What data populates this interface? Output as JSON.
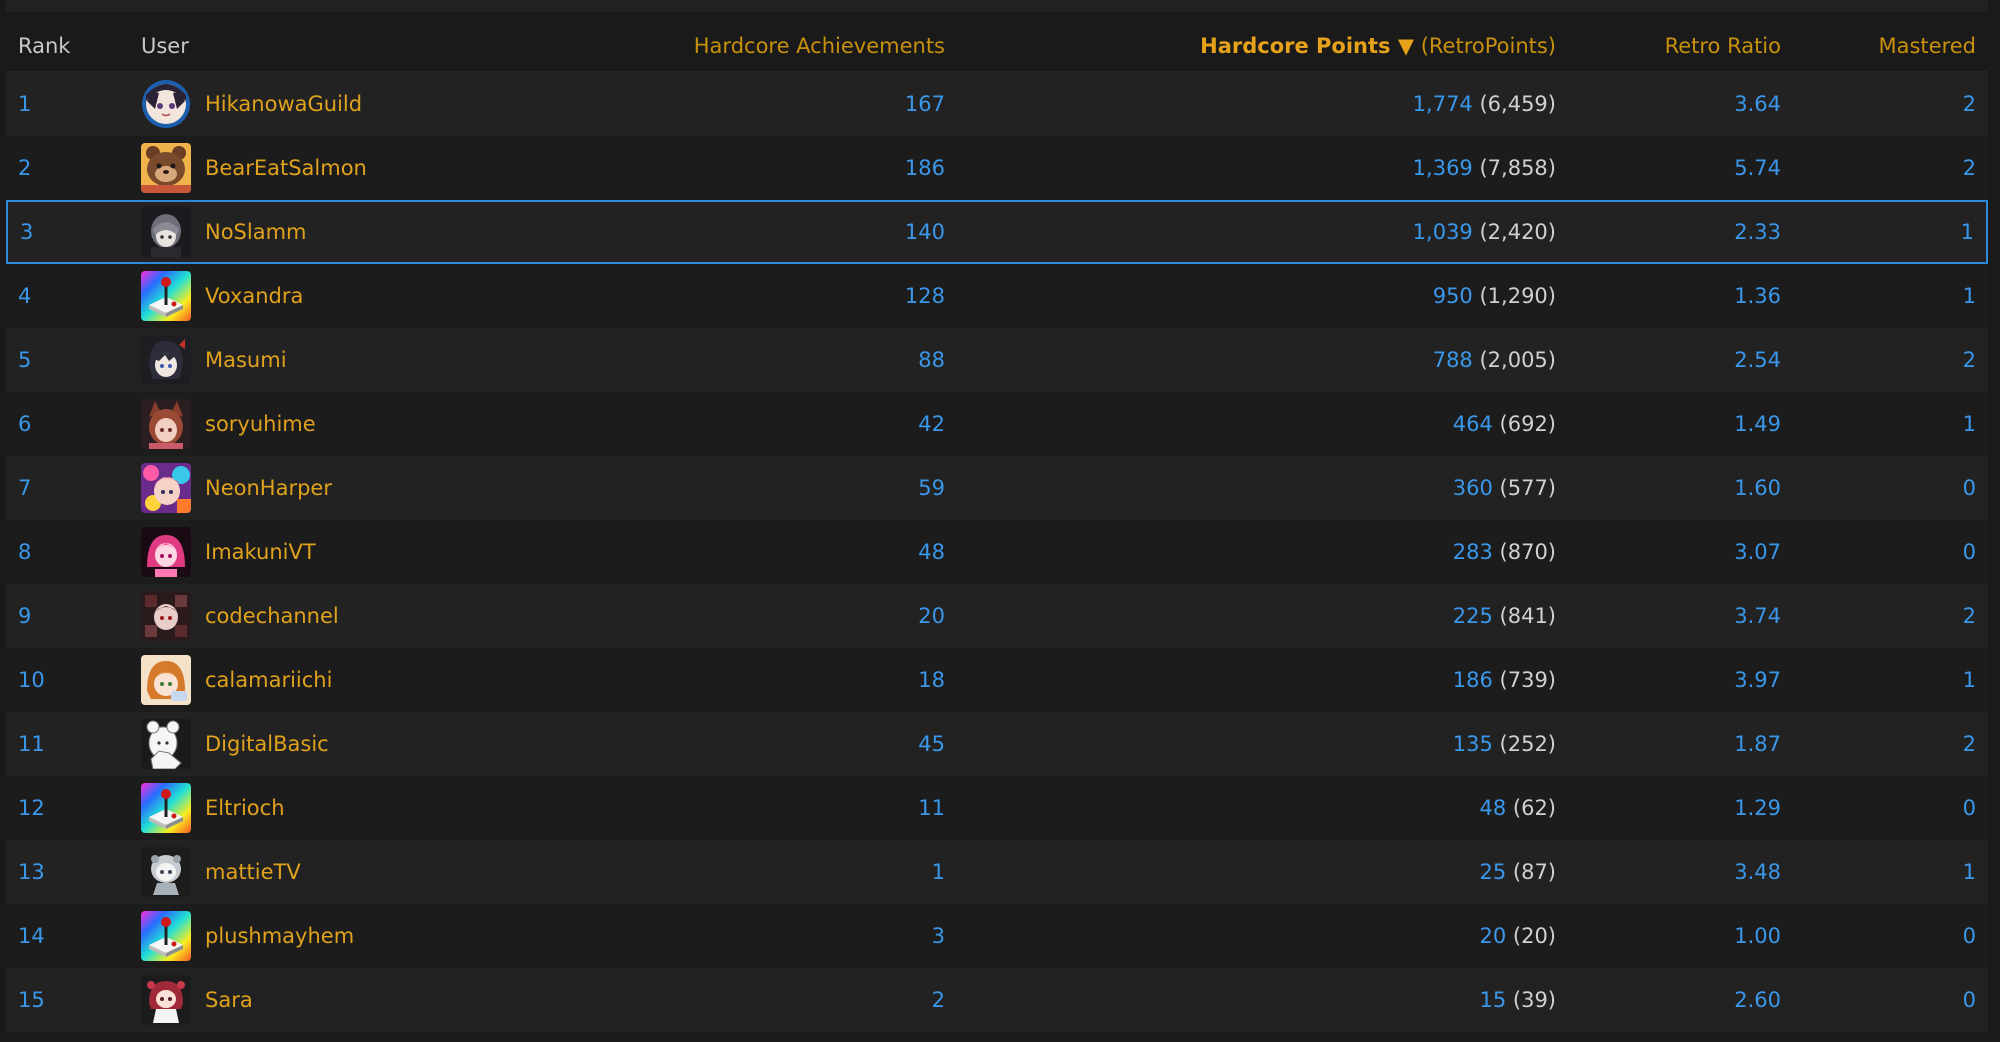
{
  "header": {
    "rank": "Rank",
    "user": "User",
    "hc_achievements": "Hardcore Achievements",
    "hc_points": "Hardcore Points ▼",
    "retropoints": "(RetroPoints)",
    "retro_ratio": "Retro Ratio",
    "mastered": "Mastered"
  },
  "rows": [
    {
      "rank": "1",
      "user": "HikanowaGuild",
      "achievements": "167",
      "points": "1,774",
      "retropoints": "(6,459)",
      "ratio": "3.64",
      "mastered": "2",
      "avatar_icon": "anime-avatar-blue-ring"
    },
    {
      "rank": "2",
      "user": "BearEatSalmon",
      "achievements": "186",
      "points": "1,369",
      "retropoints": "(7,858)",
      "ratio": "5.74",
      "mastered": "2",
      "avatar_icon": "bear-avatar"
    },
    {
      "rank": "3",
      "user": "NoSlamm",
      "achievements": "140",
      "points": "1,039",
      "retropoints": "(2,420)",
      "ratio": "2.33",
      "mastered": "1",
      "avatar_icon": "grey-hair-avatar"
    },
    {
      "rank": "4",
      "user": "Voxandra",
      "achievements": "128",
      "points": "950",
      "retropoints": "(1,290)",
      "ratio": "1.36",
      "mastered": "1",
      "avatar_icon": "rainbow-joystick-avatar"
    },
    {
      "rank": "5",
      "user": "Masumi",
      "achievements": "88",
      "points": "788",
      "retropoints": "(2,005)",
      "ratio": "2.54",
      "mastered": "2",
      "avatar_icon": "dark-hair-avatar"
    },
    {
      "rank": "6",
      "user": "soryuhime",
      "achievements": "42",
      "points": "464",
      "retropoints": "(692)",
      "ratio": "1.49",
      "mastered": "1",
      "avatar_icon": "cat-ears-avatar"
    },
    {
      "rank": "7",
      "user": "NeonHarper",
      "achievements": "59",
      "points": "360",
      "retropoints": "(577)",
      "ratio": "1.60",
      "mastered": "0",
      "avatar_icon": "colorful-avatar"
    },
    {
      "rank": "8",
      "user": "ImakuniVT",
      "achievements": "48",
      "points": "283",
      "retropoints": "(870)",
      "ratio": "3.07",
      "mastered": "0",
      "avatar_icon": "pink-avatar"
    },
    {
      "rank": "9",
      "user": "codechannel",
      "achievements": "20",
      "points": "225",
      "retropoints": "(841)",
      "ratio": "3.74",
      "mastered": "2",
      "avatar_icon": "dark-red-avatar"
    },
    {
      "rank": "10",
      "user": "calamariichi",
      "achievements": "18",
      "points": "186",
      "retropoints": "(739)",
      "ratio": "3.97",
      "mastered": "1",
      "avatar_icon": "orange-hair-avatar"
    },
    {
      "rank": "11",
      "user": "DigitalBasic",
      "achievements": "45",
      "points": "135",
      "retropoints": "(252)",
      "ratio": "1.87",
      "mastered": "2",
      "avatar_icon": "sketch-avatar"
    },
    {
      "rank": "12",
      "user": "Eltrioch",
      "achievements": "11",
      "points": "48",
      "retropoints": "(62)",
      "ratio": "1.29",
      "mastered": "0",
      "avatar_icon": "rainbow-joystick-avatar"
    },
    {
      "rank": "13",
      "user": "mattieTV",
      "achievements": "1",
      "points": "25",
      "retropoints": "(87)",
      "ratio": "3.48",
      "mastered": "1",
      "avatar_icon": "grey-chibi-avatar"
    },
    {
      "rank": "14",
      "user": "plushmayhem",
      "achievements": "3",
      "points": "20",
      "retropoints": "(20)",
      "ratio": "1.00",
      "mastered": "0",
      "avatar_icon": "rainbow-joystick-avatar"
    },
    {
      "rank": "15",
      "user": "Sara",
      "achievements": "2",
      "points": "15",
      "retropoints": "(39)",
      "ratio": "2.60",
      "mastered": "0",
      "avatar_icon": "red-chibi-avatar"
    }
  ],
  "colors": {
    "background": "#1a1a1a",
    "row_odd": "#222222",
    "row_even": "#1c1c1c",
    "link_blue": "#3a97ea",
    "username_gold": "#e0a21c",
    "header_gold": "#c7910c",
    "highlight_border": "#2f8ad6"
  }
}
